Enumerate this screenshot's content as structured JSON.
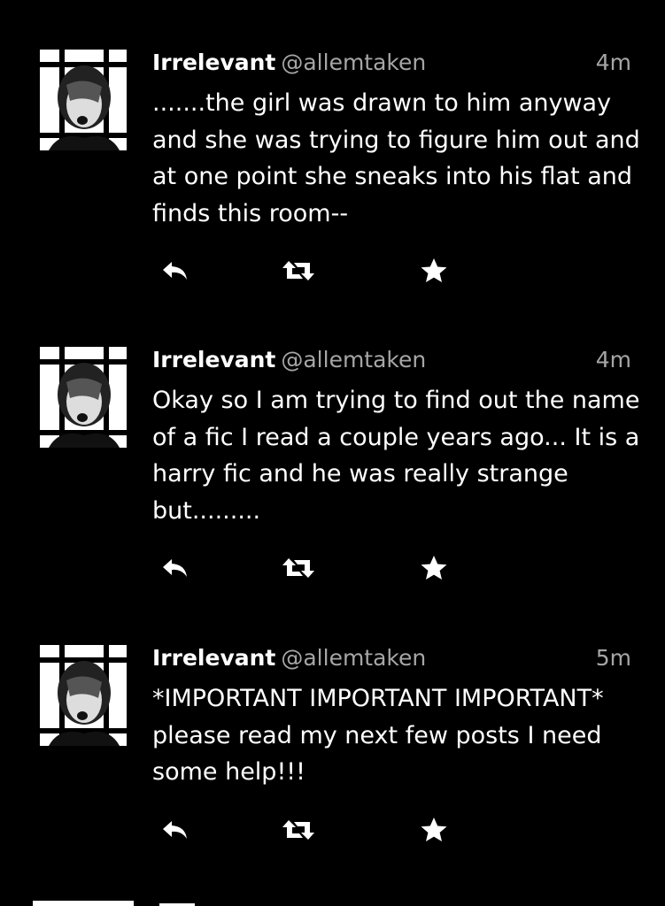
{
  "tweets": [
    {
      "name": "Irrelevant",
      "handle": "@allemtaken",
      "time": "4m",
      "text": ".......the girl was drawn to him anyway and she was trying to figure him out and at one point she sneaks into his flat and finds this room--"
    },
    {
      "name": "Irrelevant",
      "handle": "@allemtaken",
      "time": "4m",
      "text": "Okay so I am trying to find out the name of a fic I read a couple years ago... It is a harry fic and he was really strange but........."
    },
    {
      "name": "Irrelevant",
      "handle": "@allemtaken",
      "time": "5m",
      "text": "*IMPORTANT IMPORTANT IMPORTANT* please read my next few posts I need some help!!!"
    }
  ],
  "icons": {
    "reply": "reply-icon",
    "retweet": "retweet-icon",
    "favorite": "star-icon"
  },
  "colors": {
    "background": "#000000",
    "text": "#ffffff",
    "secondary_text": "#a6a6a6"
  }
}
